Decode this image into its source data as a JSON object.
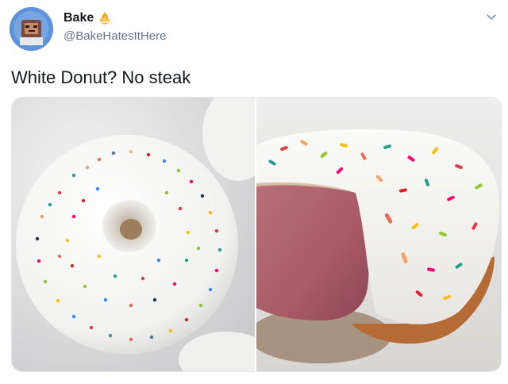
{
  "tweet": {
    "display_name": "Bake",
    "handle": "@BakeHatesItHere",
    "text": "White Donut? No steak"
  },
  "media": {
    "left_photo": "white-glazed-donut-with-sprinkles",
    "right_photo": "donut-cut-open-revealing-steak"
  },
  "icons": {
    "verified": "fire-hands-emoji",
    "menu": "chevron-down-icon"
  },
  "colors": {
    "handle_gray": "#657786",
    "text_dark": "#14171a",
    "glaze_white": "#f4f4f2",
    "steak_pink": "#b56a72"
  }
}
